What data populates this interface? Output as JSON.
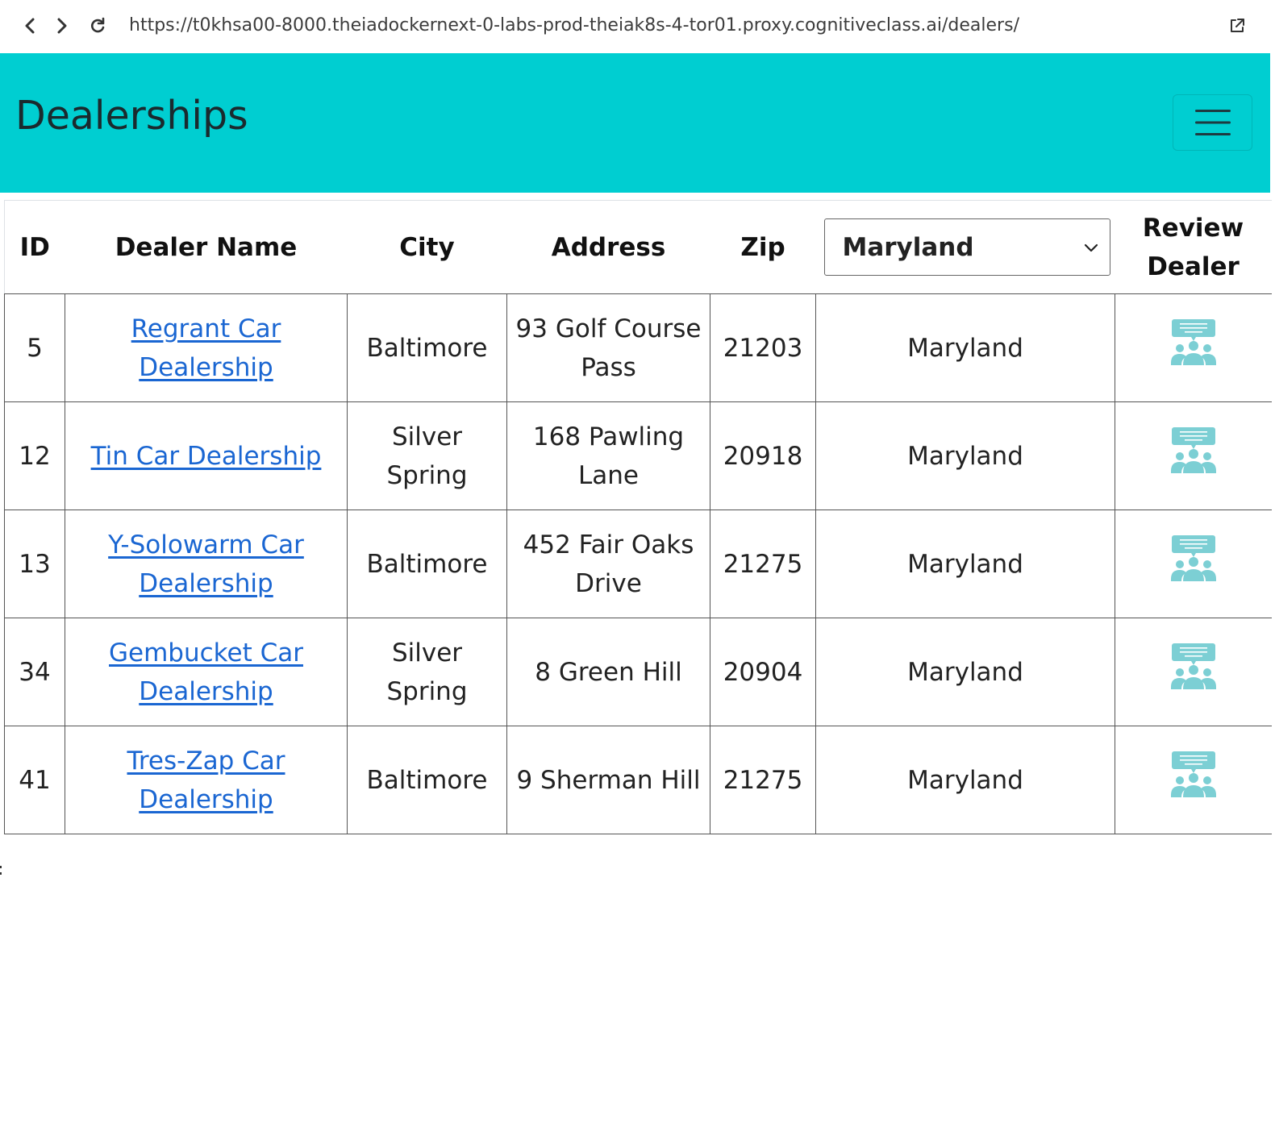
{
  "browser": {
    "url": "https://t0khsa00-8000.theiadockernext-0-labs-prod-theiak8s-4-tor01.proxy.cognitiveclass.ai/dealers/"
  },
  "navbar": {
    "brand": "Dealerships"
  },
  "table": {
    "headers": {
      "id": "ID",
      "name": "Dealer Name",
      "city": "City",
      "address": "Address",
      "zip": "Zip",
      "review_line1": "Review",
      "review_line2": "Dealer"
    },
    "state_filter": {
      "selected": "Maryland"
    },
    "rows": [
      {
        "id": "5",
        "name": "Regrant Car Dealership",
        "city": "Baltimore",
        "address": "93 Golf Course Pass",
        "zip": "21203",
        "state": "Maryland"
      },
      {
        "id": "12",
        "name": "Tin Car Dealership",
        "city": "Silver Spring",
        "address": "168 Pawling Lane",
        "zip": "20918",
        "state": "Maryland"
      },
      {
        "id": "13",
        "name": "Y-Solowarm Car Dealership",
        "city": "Baltimore",
        "address": "452 Fair Oaks Drive",
        "zip": "21275",
        "state": "Maryland"
      },
      {
        "id": "34",
        "name": "Gembucket Car Dealership",
        "city": "Silver Spring",
        "address": "8 Green Hill",
        "zip": "20904",
        "state": "Maryland"
      },
      {
        "id": "41",
        "name": "Tres-Zap Car Dealership",
        "city": "Baltimore",
        "address": "9 Sherman Hill",
        "zip": "21275",
        "state": "Maryland"
      }
    ]
  },
  "icons": {
    "review": "review-group-icon",
    "review_color": "#7ccfd4"
  },
  "colors": {
    "navbar": "#00ced1",
    "link": "#1a66d2"
  }
}
